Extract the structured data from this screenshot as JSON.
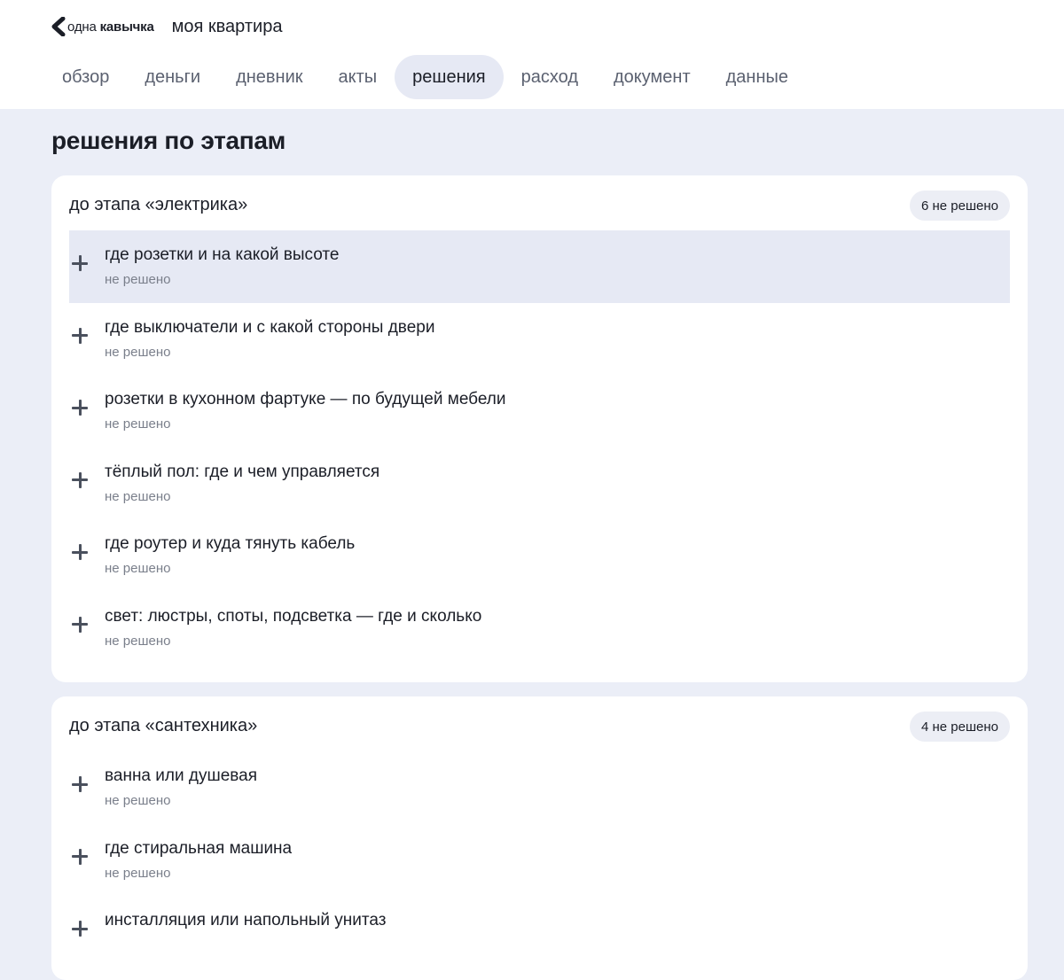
{
  "brand": {
    "icon": "chevron-quote-icon",
    "name_light": "одна",
    "name_bold": "кавычка",
    "project_name": "моя квартира"
  },
  "tabs": [
    {
      "label": "обзор",
      "active": false
    },
    {
      "label": "деньги",
      "active": false
    },
    {
      "label": "дневник",
      "active": false
    },
    {
      "label": "акты",
      "active": false
    },
    {
      "label": "решения",
      "active": true
    },
    {
      "label": "расход",
      "active": false
    },
    {
      "label": "документ",
      "active": false
    },
    {
      "label": "данные",
      "active": false
    }
  ],
  "page_title": "решения по этапам",
  "colors": {
    "background": "#ebeef7",
    "highlight": "#e6e9f4",
    "text": "#1b1e27",
    "muted": "#7a7f8b"
  },
  "groups": [
    {
      "title": "до этапа «электрика»",
      "badge": "6 не решено",
      "items": [
        {
          "title": "где розетки и на какой высоте",
          "status": "не решено",
          "icon": "plus-icon"
        },
        {
          "title": "где выключатели и с какой стороны двери",
          "status": "не решено",
          "icon": "plus-icon"
        },
        {
          "title": "розетки в кухонном фартуке — по будущей мебели",
          "status": "не решено",
          "icon": "plus-icon"
        },
        {
          "title": "тёплый пол: где и чем управляется",
          "status": "не решено",
          "icon": "plus-icon"
        },
        {
          "title": "где роутер и куда тянуть кабель",
          "status": "не решено",
          "icon": "plus-icon"
        },
        {
          "title": "свет: люстры, споты, подсветка — где и сколько",
          "status": "не решено",
          "icon": "plus-icon"
        }
      ]
    },
    {
      "title": "до этапа «сантехника»",
      "badge": "4 не решено",
      "items": [
        {
          "title": "ванна или душевая",
          "status": "не решено",
          "icon": "plus-icon"
        },
        {
          "title": "где стиральная машина",
          "status": "не решено",
          "icon": "plus-icon"
        },
        {
          "title": "инсталляция или напольный унитаз",
          "status": "",
          "icon": "plus-icon"
        }
      ]
    }
  ]
}
